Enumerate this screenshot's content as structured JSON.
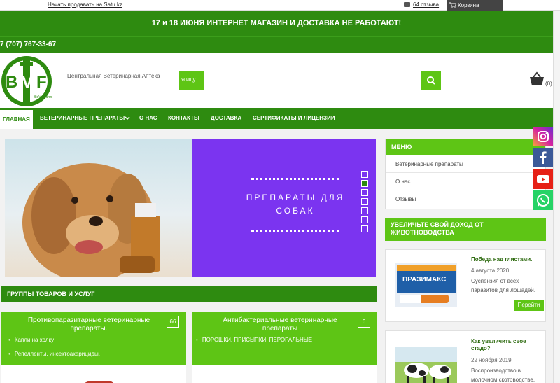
{
  "topbar": {
    "sell_link": "Начать продавать на Satu.kz",
    "reviews": "64 отзыва",
    "cart": "Корзина"
  },
  "announcement": "17 и 18 ИЮНЯ ИНТЕРНЕТ МАГАЗИН И ДОСТАВКА НЕ РАБОТАЮТ!",
  "phone": "7 (707) 767-33-67",
  "header": {
    "logo_letters": "BVF",
    "logo_caption": "BioVetFarm",
    "company": "Центральная Ветеринарная Аптека",
    "search_placeholder": "Я ищу...",
    "basket_count": "(0)"
  },
  "nav": {
    "items": [
      "ГЛАВНАЯ",
      "ВЕТЕРИНАРНЫЕ ПРЕПАРАТЫ",
      "О НАС",
      "КОНТАКТЫ",
      "ДОСТАВКА",
      "СЕРТИФИКАТЫ И ЛИЦЕНЗИИ"
    ]
  },
  "slider": {
    "slogan_line1": "ПРЕПАРАТЫ ДЛЯ",
    "slogan_line2": "СОБАК",
    "active_slide": 2,
    "slide_count": 7
  },
  "groups": {
    "title": "ГРУППЫ ТОВАРОВ И УСЛУГ",
    "cards": [
      {
        "title1": "Противопаразитарные ветеринарные",
        "title2": "препараты.",
        "count": "66",
        "items": [
          "Капли на холку",
          "Репелленты, инсектоакарициды."
        ]
      },
      {
        "title1": "Антибактериальные ветеринарные",
        "title2": "препараты",
        "count": "6",
        "items": [
          "ПОРОШКИ, ПРИСЫПКИ, ПЕРОРАЛЬНЫЕ"
        ]
      }
    ]
  },
  "menu": {
    "title": "МЕНЮ",
    "items": [
      "Ветеринарные препараты",
      "О нас",
      "Отзывы"
    ]
  },
  "income": {
    "title": "УВЕЛИЧЬТЕ СВОЙ ДОХОД ОТ ЖИВОТНОВОДСТВА"
  },
  "news": [
    {
      "title": "Победа над глистами.",
      "date": "4 августа 2020",
      "text": "Суспензия от всех паразитов для лошадей.",
      "button": "Перейти",
      "product": "ПРАЗИМАКС"
    },
    {
      "title1": "Как увеличить свое",
      "title2": "стадо?",
      "date": "22 ноября 2019",
      "text": "Воспроизводство в молочном скотоводстве."
    }
  ],
  "social": [
    "instagram-icon",
    "facebook-icon",
    "youtube-icon",
    "whatsapp-icon"
  ],
  "colors": {
    "dark_green": "#2e8b10",
    "light_green": "#5ec515",
    "purple": "#7b34f0"
  }
}
